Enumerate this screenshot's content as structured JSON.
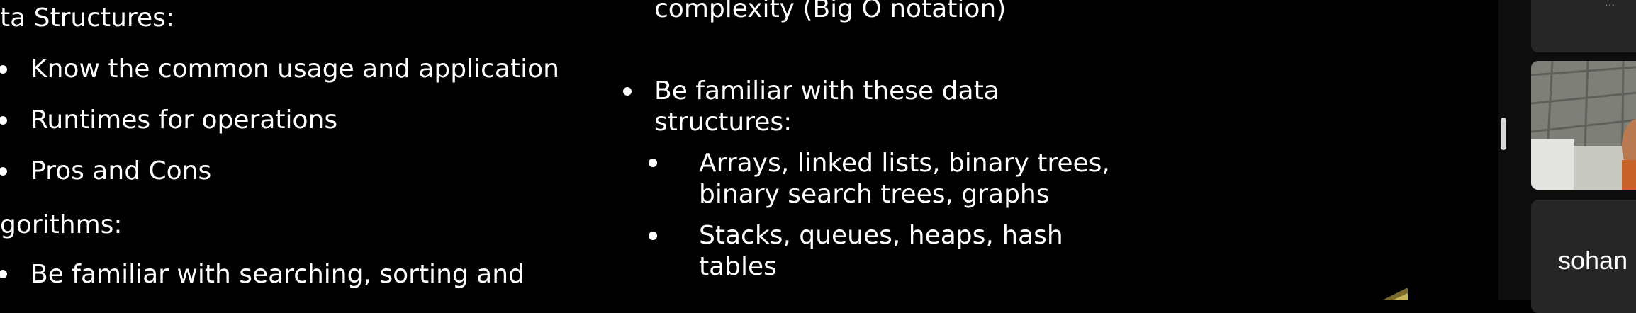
{
  "slide": {
    "left_col": {
      "heading1": "ta Structures:",
      "items1": [
        "Know the common usage and application",
        "Runtimes for operations",
        "Pros and Cons"
      ],
      "heading2": "gorithms:",
      "items2": [
        "Be familiar with searching, sorting and"
      ]
    },
    "mid_col": {
      "top_line": "complexity (Big O notation)",
      "item_line1": "Be familiar with these data",
      "item_line2": "structures:",
      "sub1_line1": "Arrays, linked lists, binary trees,",
      "sub1_line2": "binary search trees, graphs",
      "sub2_line1": "Stacks, queues, heaps, hash",
      "sub2_line2": "tables"
    }
  },
  "panel": {
    "top_tile_text": "…",
    "participant_name": "sohan"
  }
}
